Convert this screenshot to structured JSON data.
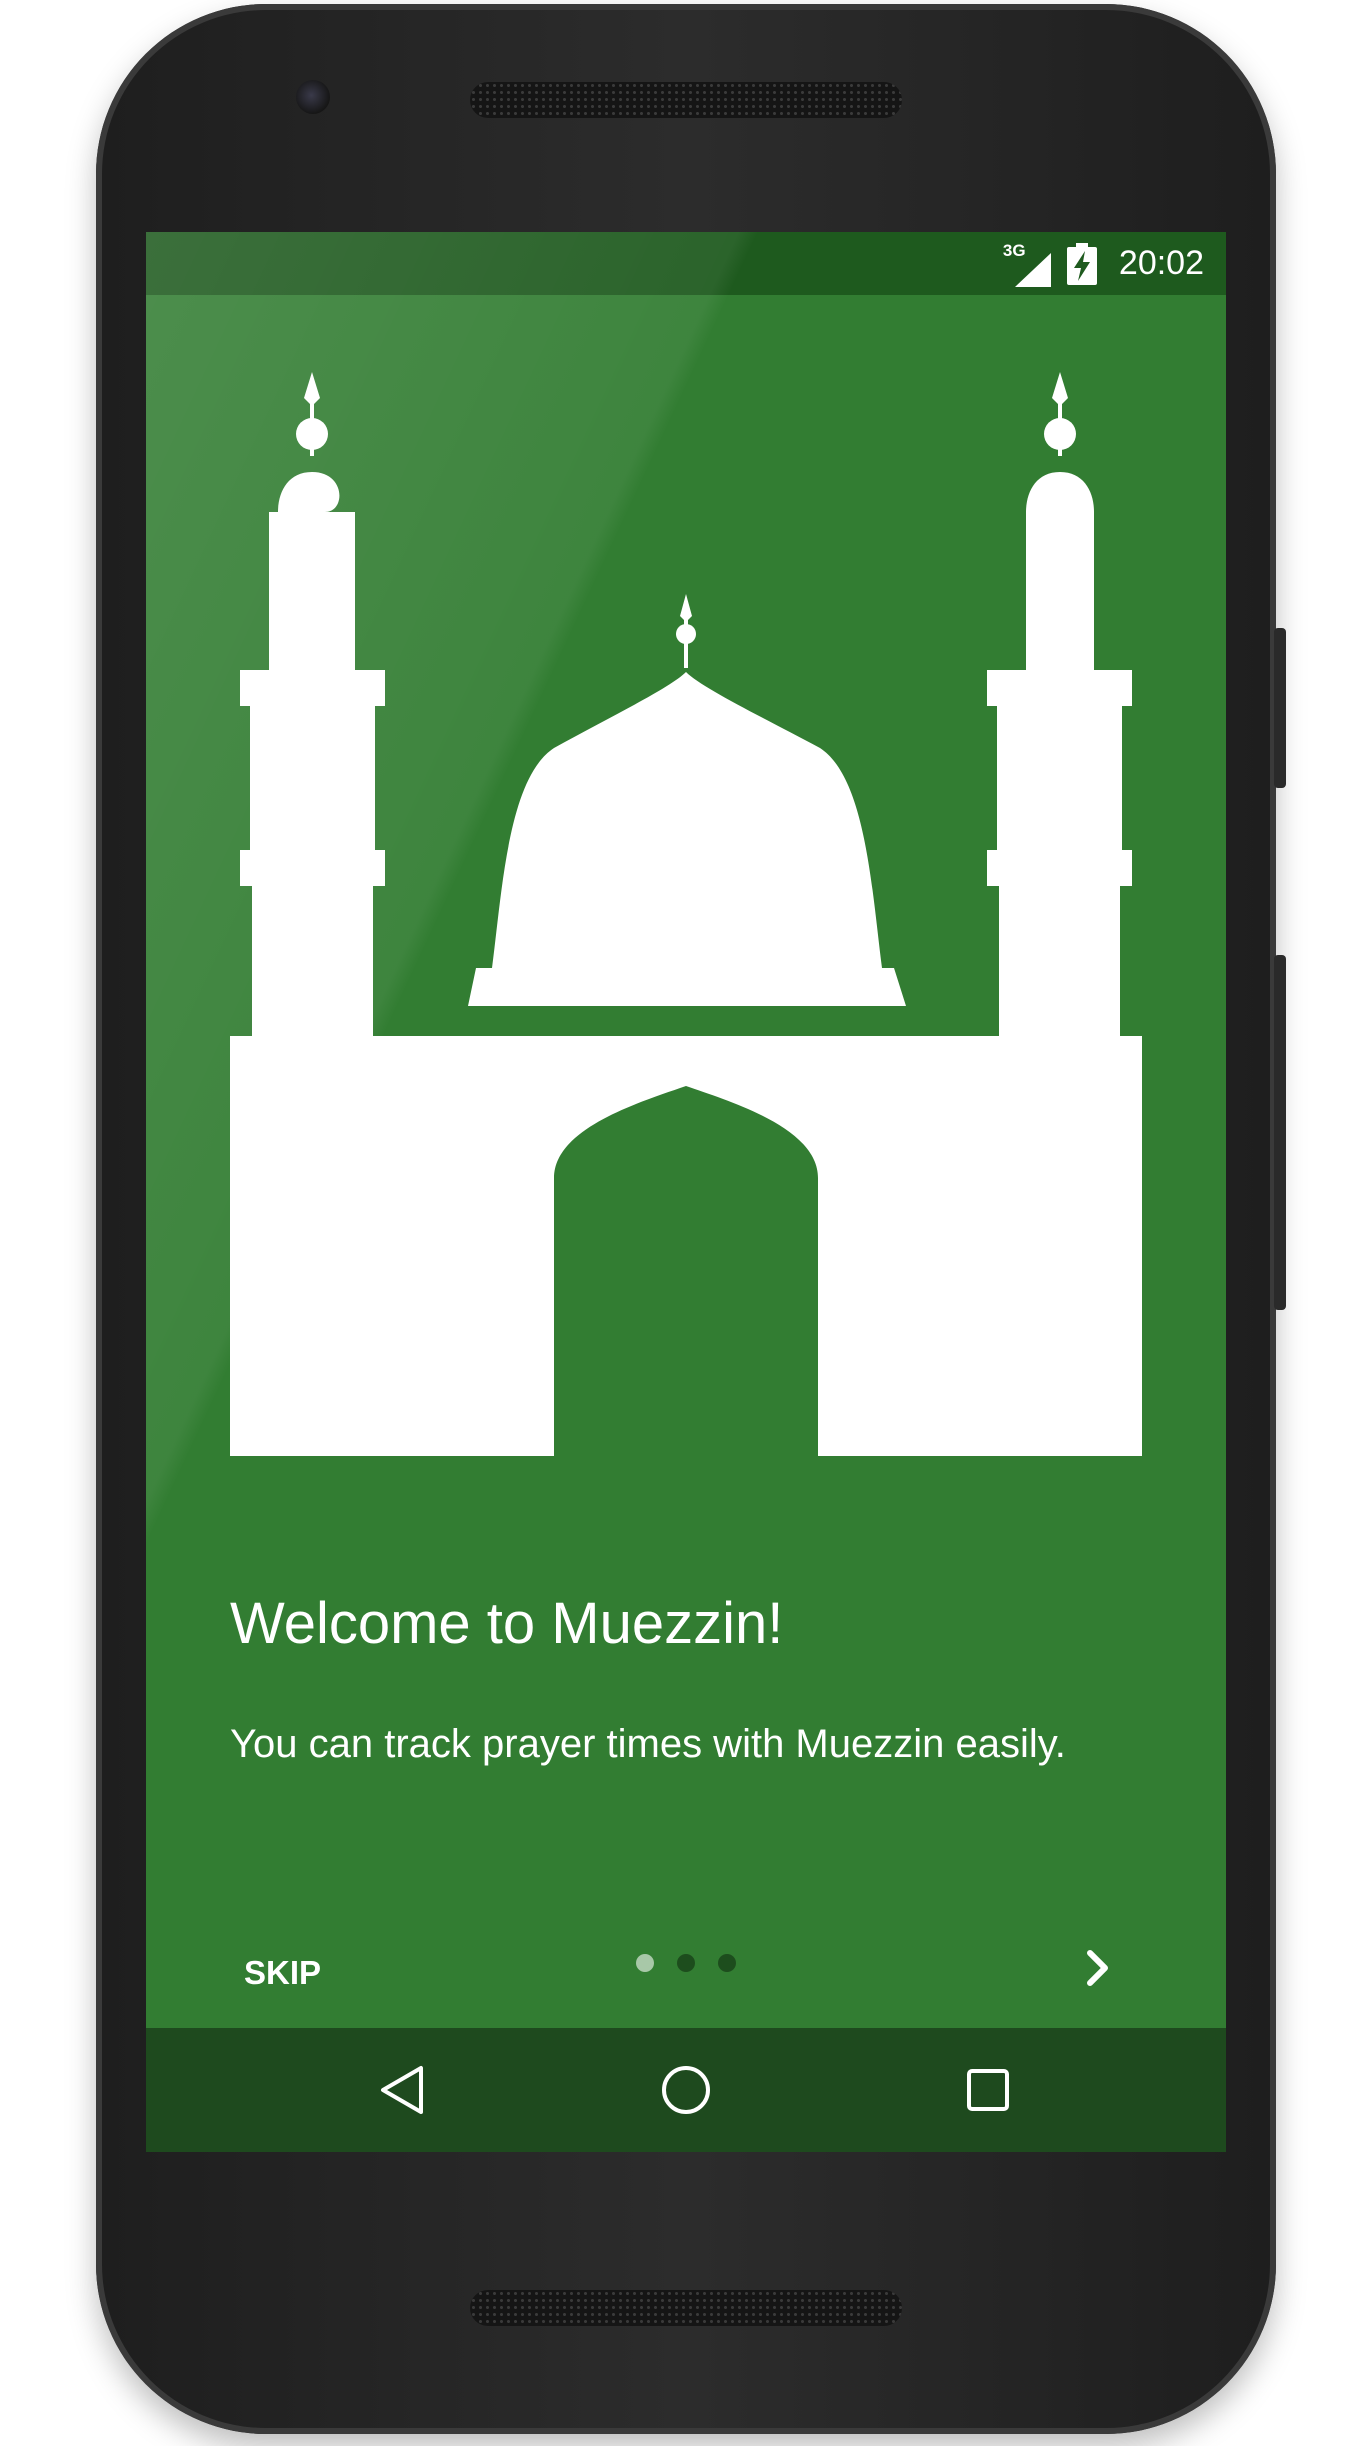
{
  "status_bar": {
    "network": "3G",
    "time": "20:02",
    "icons": [
      "signal-icon",
      "battery-charging-icon"
    ]
  },
  "onboarding": {
    "illustration": "mosque-icon",
    "title": "Welcome to Muezzin!",
    "description": "You can track prayer times with Muezzin easily.",
    "skip_label": "SKIP",
    "next_icon": "chevron-right-icon",
    "page_indicator": {
      "current": 1,
      "total": 3
    }
  },
  "nav_bar": {
    "buttons": [
      "back-icon",
      "home-icon",
      "recents-icon"
    ]
  },
  "colors": {
    "background": "#327d32",
    "status_bar": "#1e5a1e",
    "nav_bar": "#1e4a1e",
    "text": "#ffffff",
    "dot_active": "#a8c8a8",
    "dot_inactive": "#1d4d1d"
  }
}
